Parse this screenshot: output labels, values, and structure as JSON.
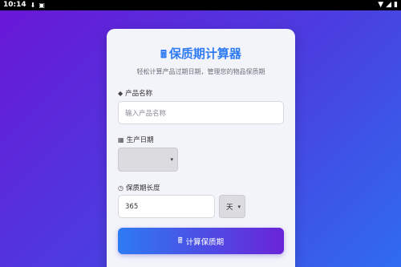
{
  "status_bar": {
    "time": "10:14",
    "icons": [
      "download-icon",
      "notification-icon",
      "wifi-icon",
      "signal-icon",
      "battery-icon"
    ]
  },
  "app": {
    "title": "保质期计算器",
    "subtitle": "轻松计算产品过期日期，管理您的物品保质期"
  },
  "form": {
    "product_name": {
      "label": "产品名称",
      "placeholder": "输入产品名称",
      "value": ""
    },
    "production_date": {
      "label": "生产日期",
      "value": ""
    },
    "shelf_life": {
      "label": "保质期长度",
      "value": "365",
      "unit": "天"
    }
  },
  "actions": {
    "calculate_label": "计算保质期"
  },
  "colors": {
    "accent": "#2e7bf2",
    "gradient_start": "#6a16d6",
    "gradient_end": "#2f6cf0"
  }
}
